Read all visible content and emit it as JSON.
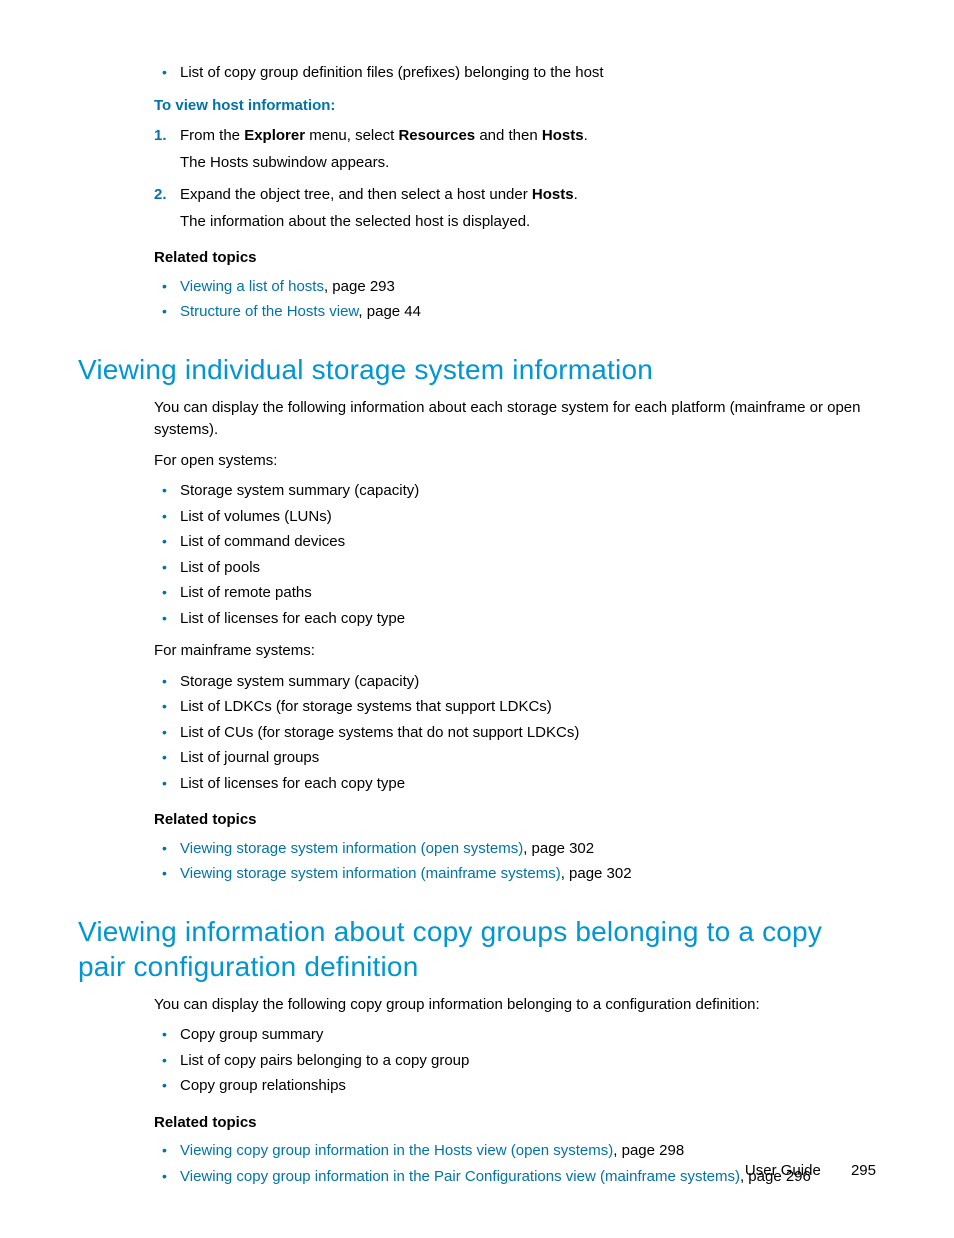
{
  "topBullet": "List of copy group definition files (prefixes) belonging to the host",
  "procHeading": "To view host information:",
  "steps": [
    {
      "num": "1.",
      "parts": [
        "From the ",
        "Explorer",
        " menu, select ",
        "Resources",
        " and then ",
        "Hosts",
        "."
      ],
      "followup": "The Hosts subwindow appears."
    },
    {
      "num": "2.",
      "parts": [
        "Expand the object tree, and then select a host under ",
        "Hosts",
        "."
      ],
      "followup": "The information about the selected host is displayed."
    }
  ],
  "related1": {
    "title": "Related topics",
    "items": [
      {
        "link": "Viewing a list of hosts",
        "rest": ", page 293"
      },
      {
        "link": "Structure of the Hosts view",
        "rest": ", page 44"
      }
    ]
  },
  "section1": {
    "heading": "Viewing individual storage system information",
    "intro": "You can display the following information about each storage system for each platform (mainframe or open systems).",
    "openLabel": "For open systems:",
    "openItems": [
      "Storage system summary (capacity)",
      "List of volumes (LUNs)",
      "List of command devices",
      "List of pools",
      "List of remote paths",
      "List of licenses for each copy type"
    ],
    "mfLabel": "For mainframe systems:",
    "mfItems": [
      "Storage system summary (capacity)",
      "List of LDKCs (for storage systems that support LDKCs)",
      "List of CUs (for storage systems that do not support LDKCs)",
      "List of journal groups",
      "List of licenses for each copy type"
    ],
    "related": {
      "title": "Related topics",
      "items": [
        {
          "link": "Viewing storage system information (open systems)",
          "rest": ", page 302"
        },
        {
          "link": "Viewing storage system information (mainframe systems)",
          "rest": ", page 302"
        }
      ]
    }
  },
  "section2": {
    "heading": "Viewing information about copy groups belonging to a copy pair configuration definition",
    "intro": "You can display the following copy group information belonging to a configuration definition:",
    "items": [
      "Copy group summary",
      "List of copy pairs belonging to a copy group",
      "Copy group relationships"
    ],
    "related": {
      "title": "Related topics",
      "items": [
        {
          "link": "Viewing copy group information in the Hosts view (open systems)",
          "rest": ", page 298"
        },
        {
          "link": "Viewing copy group information in the Pair Configurations view (mainframe systems)",
          "rest": ", page 296"
        }
      ]
    }
  },
  "footer": {
    "label": "User Guide",
    "page": "295"
  }
}
